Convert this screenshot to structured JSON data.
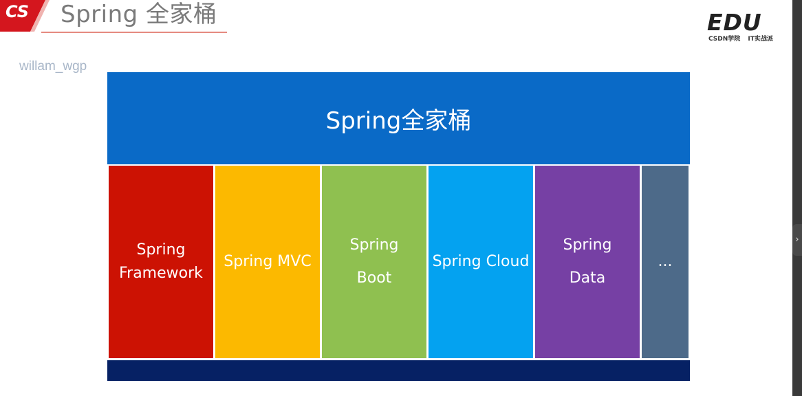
{
  "slide": {
    "title": "Spring 全家桶",
    "logo_text": "CS",
    "watermark": "willam_wgp"
  },
  "brand": {
    "name": "EDU",
    "subtitle": "CSDN学院 IT实战派",
    "accent_color": "#d4161e"
  },
  "diagram": {
    "header": "Spring全家桶",
    "header_color": "#0a6ac7",
    "columns": [
      {
        "label": "Spring\nFramework",
        "color": "#cc1203"
      },
      {
        "label": "Spring MVC",
        "color": "#fcb900"
      },
      {
        "label": "Spring\nBoot",
        "color": "#8fc050"
      },
      {
        "label": "Spring Cloud",
        "color": "#04a2f0"
      },
      {
        "label": "Spring\nData",
        "color": "#7640a4"
      },
      {
        "label": "...",
        "color": "#4d6a89"
      }
    ],
    "footer_color": "#062164"
  },
  "nav": {
    "next_icon": "chevron-right-icon"
  }
}
